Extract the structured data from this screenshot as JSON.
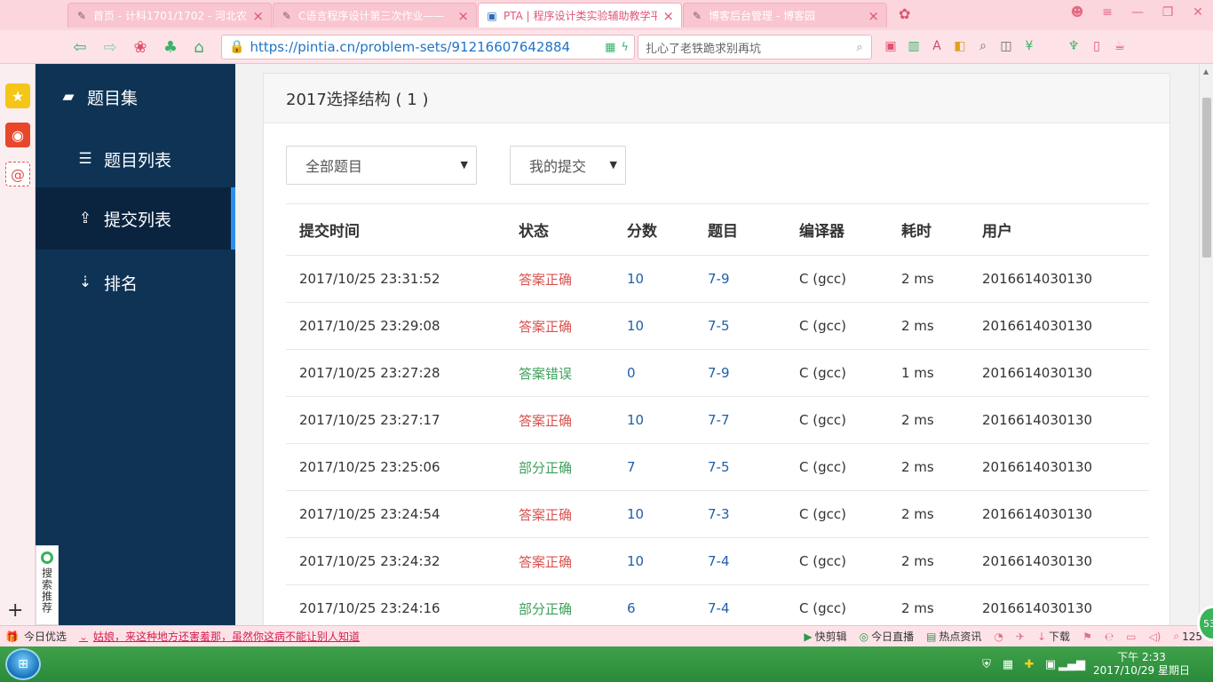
{
  "browser": {
    "tabs": [
      {
        "title": "首页 - 计科1701/1702 - 河北农",
        "active": false
      },
      {
        "title": "C语言程序设计第三次作业——",
        "active": false
      },
      {
        "title": "PTA | 程序设计类实验辅助教学平",
        "active": true
      },
      {
        "title": "博客后台管理 - 博客园",
        "active": false
      }
    ],
    "url": "https://pintia.cn/problem-sets/91216607642884",
    "search_placeholder": "扎心了老铁跪求别再坑",
    "status_left": "今日优选",
    "status_news": "姑娘，来这种地方还害羞那，虽然你这病不能让别人知道",
    "status_right": [
      "快剪辑",
      "今日直播",
      "热点资讯",
      "下载",
      "125"
    ],
    "badge_count": "53",
    "recommend_label": "搜索推荐"
  },
  "sidebar": {
    "title": "题目集",
    "items": [
      {
        "label": "题目列表",
        "active": false
      },
      {
        "label": "提交列表",
        "active": true
      },
      {
        "label": "排名",
        "active": false
      }
    ]
  },
  "page": {
    "heading": "2017选择结构 ( 1 )",
    "filter_problem": "全部题目",
    "filter_submit": "我的提交"
  },
  "table": {
    "headers": [
      "提交时间",
      "状态",
      "分数",
      "题目",
      "编译器",
      "耗时",
      "用户"
    ],
    "rows": [
      {
        "time": "2017/10/25 23:31:52",
        "status": "答案正确",
        "status_type": "ok",
        "score": "10",
        "problem": "7-9",
        "compiler": "C (gcc)",
        "cost": "2 ms",
        "user": "2016614030130"
      },
      {
        "time": "2017/10/25 23:29:08",
        "status": "答案正确",
        "status_type": "ok",
        "score": "10",
        "problem": "7-5",
        "compiler": "C (gcc)",
        "cost": "2 ms",
        "user": "2016614030130"
      },
      {
        "time": "2017/10/25 23:27:28",
        "status": "答案错误",
        "status_type": "bad",
        "score": "0",
        "problem": "7-9",
        "compiler": "C (gcc)",
        "cost": "1 ms",
        "user": "2016614030130"
      },
      {
        "time": "2017/10/25 23:27:17",
        "status": "答案正确",
        "status_type": "ok",
        "score": "10",
        "problem": "7-7",
        "compiler": "C (gcc)",
        "cost": "2 ms",
        "user": "2016614030130"
      },
      {
        "time": "2017/10/25 23:25:06",
        "status": "部分正确",
        "status_type": "part",
        "score": "7",
        "problem": "7-5",
        "compiler": "C (gcc)",
        "cost": "2 ms",
        "user": "2016614030130"
      },
      {
        "time": "2017/10/25 23:24:54",
        "status": "答案正确",
        "status_type": "ok",
        "score": "10",
        "problem": "7-3",
        "compiler": "C (gcc)",
        "cost": "2 ms",
        "user": "2016614030130"
      },
      {
        "time": "2017/10/25 23:24:32",
        "status": "答案正确",
        "status_type": "ok",
        "score": "10",
        "problem": "7-4",
        "compiler": "C (gcc)",
        "cost": "2 ms",
        "user": "2016614030130"
      },
      {
        "time": "2017/10/25 23:24:16",
        "status": "部分正确",
        "status_type": "part",
        "score": "6",
        "problem": "7-4",
        "compiler": "C (gcc)",
        "cost": "2 ms",
        "user": "2016614030130"
      }
    ]
  },
  "taskbar": {
    "time": "下午 2:33",
    "date": "2017/10/29 星期日"
  },
  "colors": {
    "sidebar_bg": "#0e3355",
    "accent": "#2c8ff0",
    "status_ok": "#d9534f",
    "status_bad": "#3da05a",
    "link": "#1f5fa8"
  }
}
